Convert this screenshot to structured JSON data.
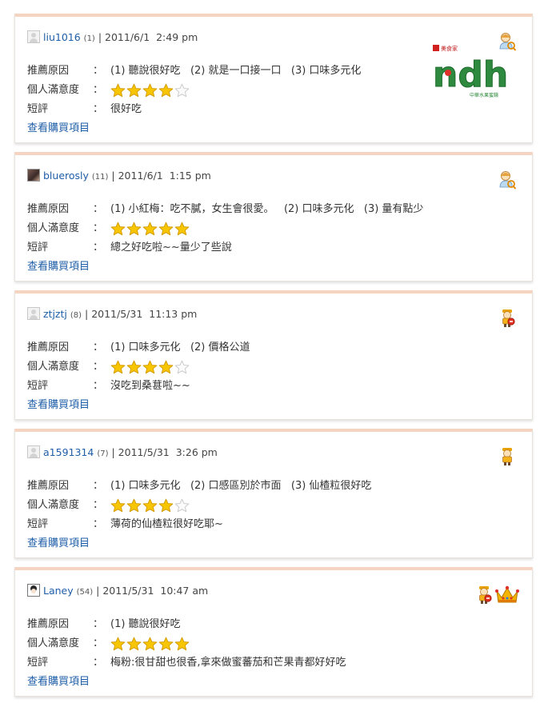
{
  "labels": {
    "reason": "推薦原因",
    "satisfaction": "個人滿意度",
    "comment": "短評",
    "colon": "：",
    "view_items": "查看購買項目"
  },
  "colors": {
    "link": "#1f5ea8",
    "star": "#f4c400",
    "card_top": "#f5d4c2",
    "logo_green": "#2e8a3e"
  },
  "logo": {
    "brand_small": "美食家",
    "wordmark": "ndh",
    "caption": "中華水果蜜餞"
  },
  "reviews": [
    {
      "avatar": "default-avatar",
      "username": "liu1016",
      "count": "(1)",
      "datetime": "| 2011/6/1  2:49 pm",
      "reasons": "(1) 聽說很好吃   (2) 就是一口接一口   (3) 口味多元化",
      "rating": 4,
      "max_rating": 5,
      "comment": "很好吃",
      "badges": [
        "member-search-icon"
      ]
    },
    {
      "avatar": "photo-avatar",
      "username": "bluerosly",
      "count": "(11)",
      "datetime": "| 2011/6/1  1:15 pm",
      "reasons": "(1) 小紅梅：吃不膩，女生會很愛。   (2) 口味多元化   (3) 量有點少",
      "rating": 5,
      "max_rating": 5,
      "comment": "總之好吃啦~~量少了些說",
      "badges": [
        "member-search-icon"
      ]
    },
    {
      "avatar": "default-avatar",
      "username": "ztjztj",
      "count": "(8)",
      "datetime": "| 2011/5/31  11:13 pm",
      "reasons": "(1) 口味多元化   (2) 價格公道",
      "rating": 4,
      "max_rating": 5,
      "comment": "沒吃到桑葚啦~~",
      "badges": [
        "courier-red-badge-icon"
      ]
    },
    {
      "avatar": "default-avatar",
      "username": "a1591314",
      "count": "(7)",
      "datetime": "| 2011/5/31  3:26 pm",
      "reasons": "(1) 口味多元化   (2) 口感區別於市面   (3) 仙楂粒很好吃",
      "rating": 4,
      "max_rating": 5,
      "comment": "薄荷的仙楂粒很好吃耶~",
      "badges": [
        "courier-badge-icon"
      ]
    },
    {
      "avatar": "face-avatar",
      "username": "Laney",
      "count": "(54)",
      "datetime": "| 2011/5/31  10:47 am",
      "reasons": "(1) 聽說很好吃",
      "rating": 5,
      "max_rating": 5,
      "comment": "梅粉:很甘甜也很香,拿來做蜜蕃茄和芒果青都好好吃",
      "badges": [
        "courier-red-badge-icon",
        "crown-icon"
      ]
    }
  ]
}
